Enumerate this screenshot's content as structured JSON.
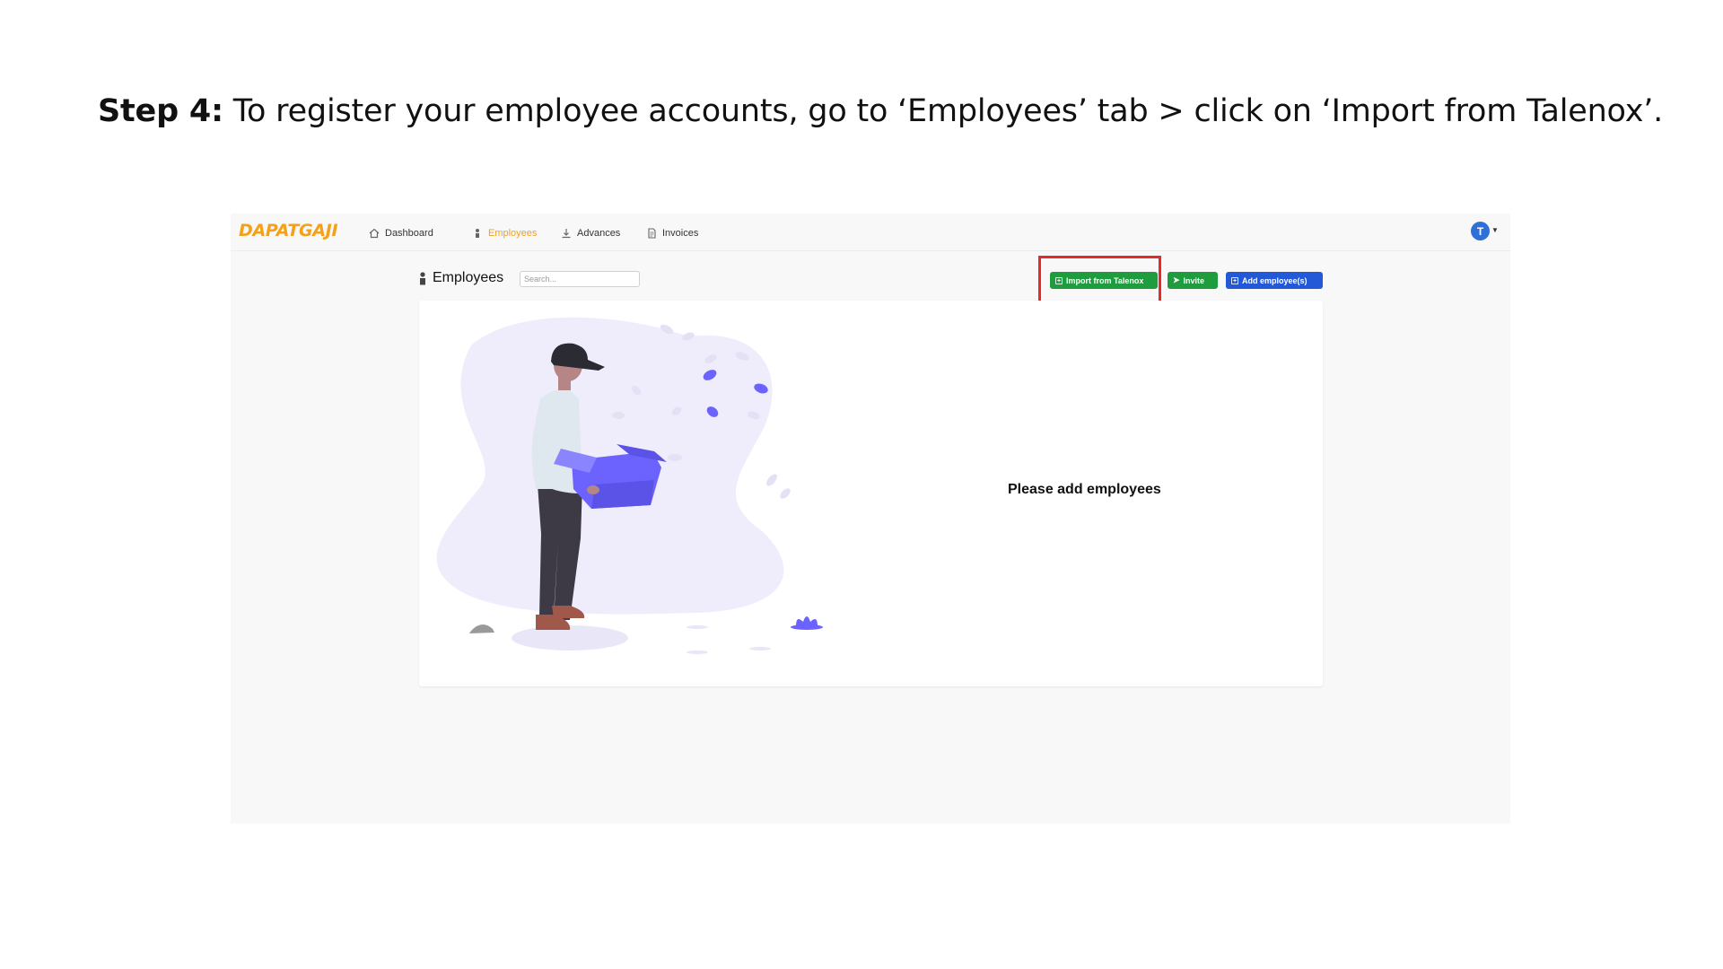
{
  "instruction": {
    "step": "Step 4:",
    "text": " To register your employee accounts, go to ‘Employees’ tab > click on ‘Import from Talenox’."
  },
  "app": {
    "logo": "DAPATGAJI",
    "nav": [
      {
        "label": "Dashboard",
        "icon": "home-icon",
        "active": false
      },
      {
        "label": "Employees",
        "icon": "person-icon",
        "active": true
      },
      {
        "label": "Advances",
        "icon": "advance-icon",
        "active": false
      },
      {
        "label": "Invoices",
        "icon": "document-icon",
        "active": false
      }
    ],
    "avatar_initial": "T",
    "accent_color": "#f4a019"
  },
  "page": {
    "title": "Employees",
    "search_placeholder": "Search...",
    "buttons": {
      "import": "Import from Talenox",
      "invite": "Invite",
      "add": "Add employee(s)"
    },
    "empty_message": "Please add employees"
  },
  "colors": {
    "green_button": "#1f9d3e",
    "blue_button": "#2358d6",
    "highlight_box": "#e42b2b",
    "illustration_purple": "#6c63ff"
  }
}
